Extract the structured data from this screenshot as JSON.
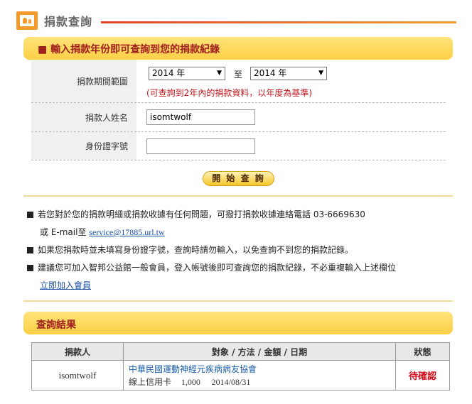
{
  "header": {
    "title": "捐款查詢"
  },
  "search_bar": {
    "title": "■ 輸入捐款年份即可查詢到您的捐款紀錄"
  },
  "form": {
    "period_label": "捐款期間範圍",
    "year_from": "2014 年",
    "to_label": "至",
    "year_to": "2014 年",
    "hint": "(可查詢到2年內的捐款資料，以年度為基準)",
    "name_label": "捐款人姓名",
    "name_value": "isomtwolf",
    "id_label": "身份證字號",
    "id_value": "",
    "search_button": "開 始 查 詢"
  },
  "notes": {
    "line1": "若您對於您的捐款明細或捐款收據有任何問題，可撥打捐款收據連絡電話 03-6669630",
    "email_prefix": "或 E-mail至",
    "email": "service@17885.url.tw",
    "line2": "如果您捐款時並未填寫身份證字號，查詢時請勿輸入，以免查詢不到您的捐款記錄。",
    "line3": "建議您可加入智邦公益館一般會員，登入帳號後即可查詢您的捐款紀錄，不必重複輸入上述欄位",
    "join_link": "立即加入會員"
  },
  "results_bar": {
    "title": "查詢結果"
  },
  "results": {
    "headers": [
      "捐款人",
      "對象 / 方法 / 金額 / 日期",
      "狀態"
    ],
    "rows": [
      {
        "donor": "isomtwolf",
        "org": "中華民國運動神經元疾病病友協會",
        "method": "線上信用卡",
        "amount": "1,000",
        "date": "2014/08/31",
        "status": "待確認"
      }
    ]
  },
  "colors": {
    "accent_red": "#a01e1e",
    "link_blue": "#1a4fa6",
    "bar_yellow": "#fcd045",
    "status_red": "#d0101a"
  }
}
